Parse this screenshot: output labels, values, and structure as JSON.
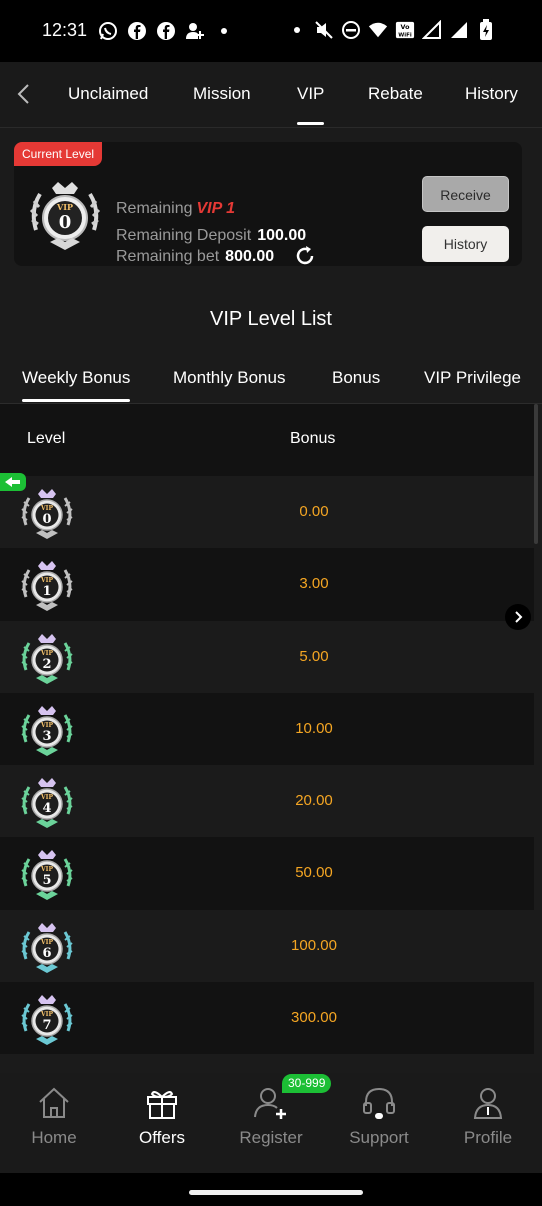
{
  "status_bar": {
    "time": "12:31",
    "left_icons": [
      "whatsapp-icon",
      "facebook-icon",
      "facebook-icon",
      "add-contact-icon",
      "dot-icon"
    ],
    "right_icons": [
      "dot-icon",
      "mute-icon",
      "do-not-disturb-icon",
      "wifi-icon",
      "vowifi-icon",
      "signal-icon",
      "signal-full-icon",
      "battery-icon"
    ],
    "vowifi_label": "Vo WiFi"
  },
  "top_nav": {
    "tabs": [
      {
        "label": "Unclaimed"
      },
      {
        "label": "Mission"
      },
      {
        "label": "VIP",
        "active": true
      },
      {
        "label": "Rebate"
      },
      {
        "label": "History"
      }
    ]
  },
  "level_card": {
    "tag": "Current Level",
    "badge_top": "VIP",
    "badge_level": "0",
    "remaining_label": "Remaining",
    "remaining_vip": "VIP 1",
    "deposit_label": "Remaining Deposit",
    "deposit_value": "100.00",
    "bet_label": "Remaining bet",
    "bet_value": "800.00",
    "receive_button": "Receive",
    "history_button": "History"
  },
  "vip_list": {
    "title": "VIP Level List",
    "tabs": [
      {
        "label": "Weekly Bonus",
        "active": true
      },
      {
        "label": "Monthly Bonus"
      },
      {
        "label": "Bonus"
      },
      {
        "label": "VIP Privilege"
      }
    ],
    "col_level": "Level",
    "col_bonus": "Bonus",
    "rows": [
      {
        "badge_top": "VIP",
        "level": "0",
        "bonus": "0.00",
        "color": "#c0c0c0"
      },
      {
        "badge_top": "VIP",
        "level": "1",
        "bonus": "3.00",
        "color": "#c0c0c0"
      },
      {
        "badge_top": "VIP",
        "level": "2",
        "bonus": "5.00",
        "color": "#6bd39a"
      },
      {
        "badge_top": "VIP",
        "level": "3",
        "bonus": "10.00",
        "color": "#6bd39a"
      },
      {
        "badge_top": "VIP",
        "level": "4",
        "bonus": "20.00",
        "color": "#6bd39a"
      },
      {
        "badge_top": "VIP",
        "level": "5",
        "bonus": "50.00",
        "color": "#6bd39a"
      },
      {
        "badge_top": "VIP",
        "level": "6",
        "bonus": "100.00",
        "color": "#6bc8d3"
      },
      {
        "badge_top": "VIP",
        "level": "7",
        "bonus": "300.00",
        "color": "#6bc8d3"
      }
    ]
  },
  "bottom_nav": {
    "items": [
      {
        "label": "Home",
        "icon": "home-icon"
      },
      {
        "label": "Offers",
        "icon": "gift-icon",
        "active": true
      },
      {
        "label": "Register",
        "icon": "add-user-icon"
      },
      {
        "label": "Support",
        "icon": "headset-icon"
      },
      {
        "label": "Profile",
        "icon": "profile-icon"
      }
    ],
    "register_badge": "30-999"
  },
  "colors": {
    "accent_red": "#e53935",
    "bonus_orange": "#f5a623",
    "badge_green": "#1cbf35"
  }
}
